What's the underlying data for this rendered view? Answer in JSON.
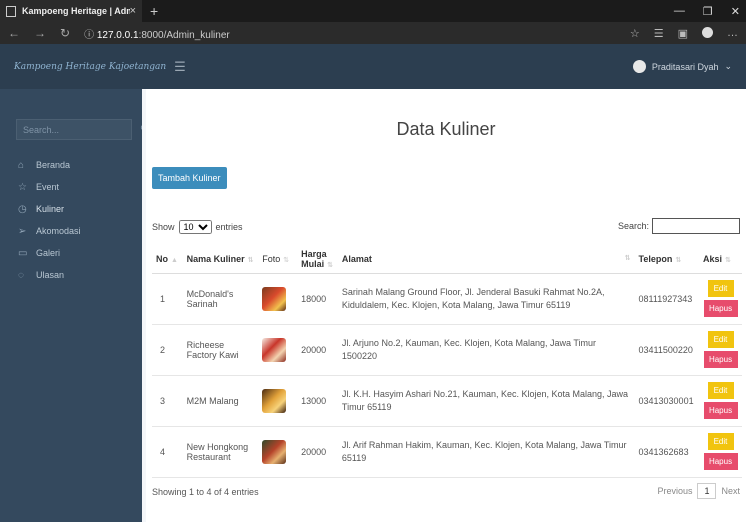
{
  "browser": {
    "tab_title": "Kampoeng Heritage | Admin",
    "tab_close": "×",
    "new_tab": "+",
    "url_host": "127.0.0.1",
    "url_rest": ":8000/Admin_kuliner"
  },
  "navbar": {
    "brand": "Kampoeng Heritage Kajoetangan",
    "user_name": "Praditasari Dyah"
  },
  "sidebar": {
    "search_placeholder": "Search...",
    "items": [
      {
        "label": "Beranda",
        "icon": "home-icon"
      },
      {
        "label": "Event",
        "icon": "star-icon"
      },
      {
        "label": "Kuliner",
        "icon": "clock-icon"
      },
      {
        "label": "Akomodasi",
        "icon": "send-icon"
      },
      {
        "label": "Galeri",
        "icon": "image-icon"
      },
      {
        "label": "Ulasan",
        "icon": "chat-icon"
      }
    ]
  },
  "main": {
    "title": "Data Kuliner",
    "add_button": "Tambah Kuliner",
    "show_label": "Show",
    "entries_value": "10",
    "entries_label": "entries",
    "search_label": "Search:",
    "columns": [
      "No",
      "Nama Kuliner",
      "Foto",
      "Harga Mulai",
      "Alamat",
      "Telepon",
      "Aksi"
    ],
    "rows": [
      {
        "no": "1",
        "name": "McDonald's Sarinah",
        "price": "18000",
        "address": "Sarinah Malang Ground Floor, Jl. Jenderal Basuki Rahmat No.2A, Kiduldalem, Kec. Klojen, Kota Malang, Jawa Timur 65119",
        "phone": "08111927343"
      },
      {
        "no": "2",
        "name": "Richeese Factory Kawi",
        "price": "20000",
        "address": "Jl. Arjuno No.2, Kauman, Kec. Klojen, Kota Malang, Jawa Timur 1500220",
        "phone": "03411500220"
      },
      {
        "no": "3",
        "name": "M2M Malang",
        "price": "13000",
        "address": "Jl. K.H. Hasyim Ashari No.21, Kauman, Kec. Klojen, Kota Malang, Jawa Timur 65119",
        "phone": "03413030001"
      },
      {
        "no": "4",
        "name": "New Hongkong Restaurant",
        "price": "20000",
        "address": "Jl. Arif Rahman Hakim, Kauman, Kec. Klojen, Kota Malang, Jawa Timur 65119",
        "phone": "0341362683"
      }
    ],
    "edit_label": "Edit",
    "delete_label": "Hapus",
    "footer_info": "Showing 1 to 4 of 4 entries",
    "pager": {
      "previous": "Previous",
      "page": "1",
      "next": "Next"
    }
  },
  "colors": {
    "navbar": "#2c3e50",
    "sidebar": "#34495e",
    "primary_button": "#3c8dbc",
    "edit_button": "#f1c40f",
    "delete_button": "#e74c6c"
  }
}
